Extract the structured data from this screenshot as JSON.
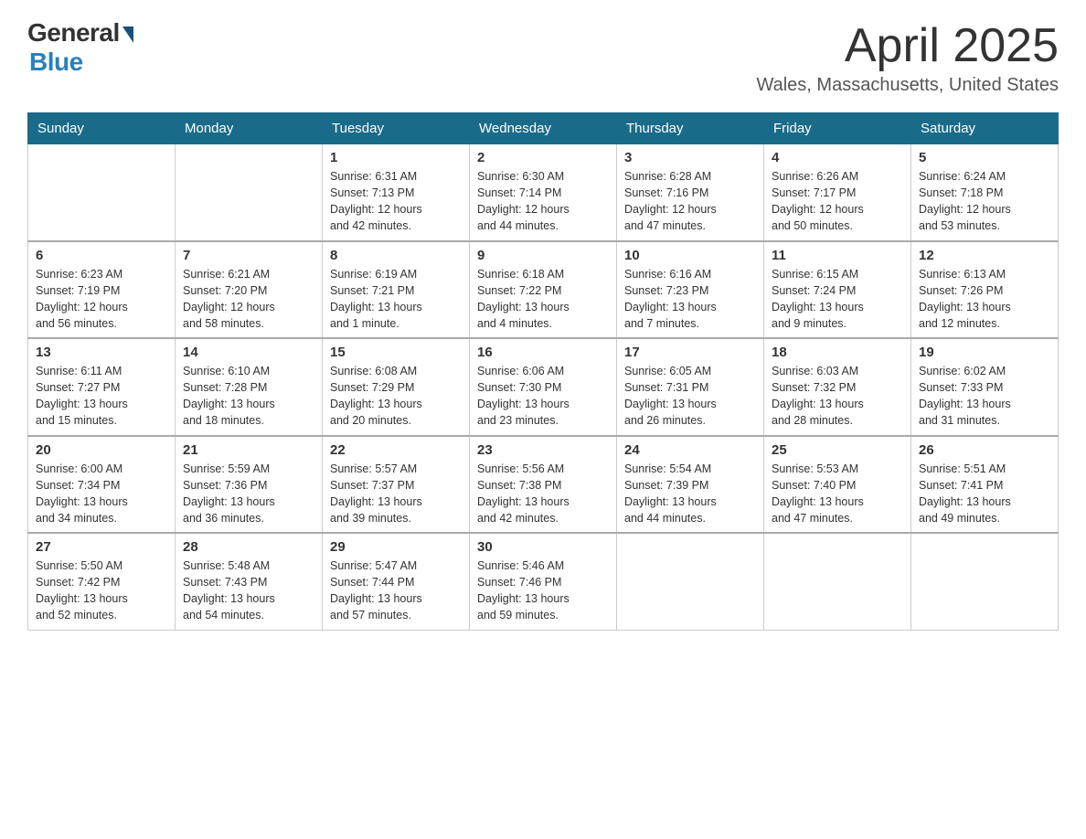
{
  "header": {
    "logo_general": "General",
    "logo_blue": "Blue",
    "title": "April 2025",
    "location": "Wales, Massachusetts, United States"
  },
  "days_of_week": [
    "Sunday",
    "Monday",
    "Tuesday",
    "Wednesday",
    "Thursday",
    "Friday",
    "Saturday"
  ],
  "weeks": [
    [
      {
        "day": "",
        "info": ""
      },
      {
        "day": "",
        "info": ""
      },
      {
        "day": "1",
        "info": "Sunrise: 6:31 AM\nSunset: 7:13 PM\nDaylight: 12 hours\nand 42 minutes."
      },
      {
        "day": "2",
        "info": "Sunrise: 6:30 AM\nSunset: 7:14 PM\nDaylight: 12 hours\nand 44 minutes."
      },
      {
        "day": "3",
        "info": "Sunrise: 6:28 AM\nSunset: 7:16 PM\nDaylight: 12 hours\nand 47 minutes."
      },
      {
        "day": "4",
        "info": "Sunrise: 6:26 AM\nSunset: 7:17 PM\nDaylight: 12 hours\nand 50 minutes."
      },
      {
        "day": "5",
        "info": "Sunrise: 6:24 AM\nSunset: 7:18 PM\nDaylight: 12 hours\nand 53 minutes."
      }
    ],
    [
      {
        "day": "6",
        "info": "Sunrise: 6:23 AM\nSunset: 7:19 PM\nDaylight: 12 hours\nand 56 minutes."
      },
      {
        "day": "7",
        "info": "Sunrise: 6:21 AM\nSunset: 7:20 PM\nDaylight: 12 hours\nand 58 minutes."
      },
      {
        "day": "8",
        "info": "Sunrise: 6:19 AM\nSunset: 7:21 PM\nDaylight: 13 hours\nand 1 minute."
      },
      {
        "day": "9",
        "info": "Sunrise: 6:18 AM\nSunset: 7:22 PM\nDaylight: 13 hours\nand 4 minutes."
      },
      {
        "day": "10",
        "info": "Sunrise: 6:16 AM\nSunset: 7:23 PM\nDaylight: 13 hours\nand 7 minutes."
      },
      {
        "day": "11",
        "info": "Sunrise: 6:15 AM\nSunset: 7:24 PM\nDaylight: 13 hours\nand 9 minutes."
      },
      {
        "day": "12",
        "info": "Sunrise: 6:13 AM\nSunset: 7:26 PM\nDaylight: 13 hours\nand 12 minutes."
      }
    ],
    [
      {
        "day": "13",
        "info": "Sunrise: 6:11 AM\nSunset: 7:27 PM\nDaylight: 13 hours\nand 15 minutes."
      },
      {
        "day": "14",
        "info": "Sunrise: 6:10 AM\nSunset: 7:28 PM\nDaylight: 13 hours\nand 18 minutes."
      },
      {
        "day": "15",
        "info": "Sunrise: 6:08 AM\nSunset: 7:29 PM\nDaylight: 13 hours\nand 20 minutes."
      },
      {
        "day": "16",
        "info": "Sunrise: 6:06 AM\nSunset: 7:30 PM\nDaylight: 13 hours\nand 23 minutes."
      },
      {
        "day": "17",
        "info": "Sunrise: 6:05 AM\nSunset: 7:31 PM\nDaylight: 13 hours\nand 26 minutes."
      },
      {
        "day": "18",
        "info": "Sunrise: 6:03 AM\nSunset: 7:32 PM\nDaylight: 13 hours\nand 28 minutes."
      },
      {
        "day": "19",
        "info": "Sunrise: 6:02 AM\nSunset: 7:33 PM\nDaylight: 13 hours\nand 31 minutes."
      }
    ],
    [
      {
        "day": "20",
        "info": "Sunrise: 6:00 AM\nSunset: 7:34 PM\nDaylight: 13 hours\nand 34 minutes."
      },
      {
        "day": "21",
        "info": "Sunrise: 5:59 AM\nSunset: 7:36 PM\nDaylight: 13 hours\nand 36 minutes."
      },
      {
        "day": "22",
        "info": "Sunrise: 5:57 AM\nSunset: 7:37 PM\nDaylight: 13 hours\nand 39 minutes."
      },
      {
        "day": "23",
        "info": "Sunrise: 5:56 AM\nSunset: 7:38 PM\nDaylight: 13 hours\nand 42 minutes."
      },
      {
        "day": "24",
        "info": "Sunrise: 5:54 AM\nSunset: 7:39 PM\nDaylight: 13 hours\nand 44 minutes."
      },
      {
        "day": "25",
        "info": "Sunrise: 5:53 AM\nSunset: 7:40 PM\nDaylight: 13 hours\nand 47 minutes."
      },
      {
        "day": "26",
        "info": "Sunrise: 5:51 AM\nSunset: 7:41 PM\nDaylight: 13 hours\nand 49 minutes."
      }
    ],
    [
      {
        "day": "27",
        "info": "Sunrise: 5:50 AM\nSunset: 7:42 PM\nDaylight: 13 hours\nand 52 minutes."
      },
      {
        "day": "28",
        "info": "Sunrise: 5:48 AM\nSunset: 7:43 PM\nDaylight: 13 hours\nand 54 minutes."
      },
      {
        "day": "29",
        "info": "Sunrise: 5:47 AM\nSunset: 7:44 PM\nDaylight: 13 hours\nand 57 minutes."
      },
      {
        "day": "30",
        "info": "Sunrise: 5:46 AM\nSunset: 7:46 PM\nDaylight: 13 hours\nand 59 minutes."
      },
      {
        "day": "",
        "info": ""
      },
      {
        "day": "",
        "info": ""
      },
      {
        "day": "",
        "info": ""
      }
    ]
  ]
}
